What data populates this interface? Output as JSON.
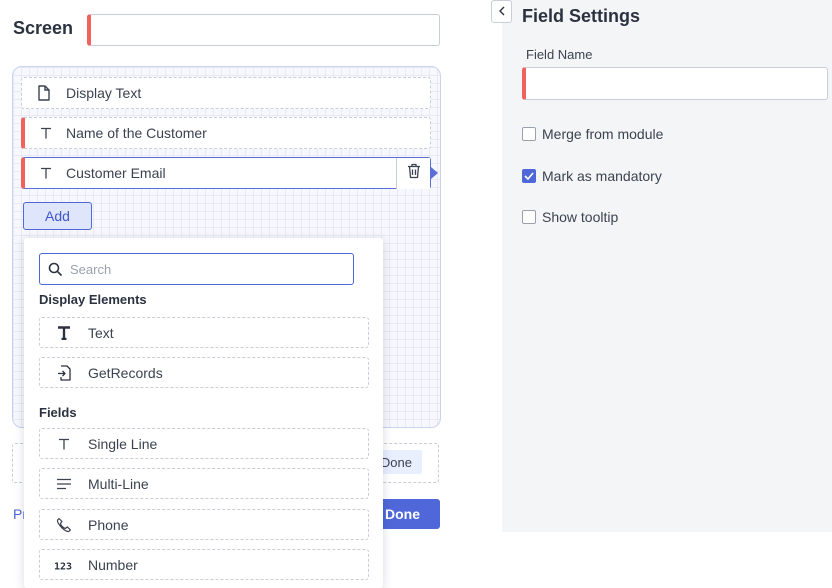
{
  "header": {
    "title": "Screen",
    "screen_name_value": ""
  },
  "canvas": {
    "fields": [
      {
        "label": "Display Text",
        "icon": "document-icon",
        "mandatory": false
      },
      {
        "label": "Name of the Customer",
        "icon": "text-t-icon",
        "mandatory": true
      },
      {
        "label": "Customer Email",
        "icon": "text-t-icon",
        "mandatory": true,
        "selected": true
      }
    ],
    "add_label": "Add"
  },
  "add_menu": {
    "search_placeholder": "Search",
    "display_elements_heading": "Display Elements",
    "display_elements": [
      {
        "label": "Text",
        "icon": "bold-t-icon"
      },
      {
        "label": "GetRecords",
        "icon": "get-records-icon"
      }
    ],
    "fields_heading": "Fields",
    "fields": [
      {
        "label": "Single Line",
        "icon": "text-t-icon"
      },
      {
        "label": "Multi-Line",
        "icon": "lines-icon"
      },
      {
        "label": "Phone",
        "icon": "phone-icon"
      },
      {
        "label": "Number",
        "icon": "number-icon"
      }
    ]
  },
  "footer": {
    "prev_label": "Pr",
    "done_chip_label": "Done",
    "done_button_label": "Done"
  },
  "field_settings": {
    "title": "Field Settings",
    "field_name_label": "Field Name",
    "field_name_value": "",
    "options": [
      {
        "label": "Merge from module",
        "checked": false
      },
      {
        "label": "Mark as mandatory",
        "checked": true
      },
      {
        "label": "Show tooltip",
        "checked": false
      }
    ]
  },
  "colors": {
    "accent": "#4f67d8",
    "mandatory": "#f0625b",
    "panel_bg": "#f4f5f7"
  }
}
